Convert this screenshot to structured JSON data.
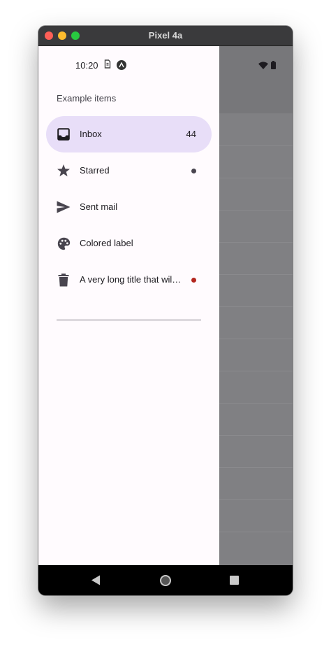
{
  "window": {
    "title": "Pixel 4a"
  },
  "status_bar": {
    "time": "10:20",
    "icons": [
      "sim-icon",
      "app-notification-icon",
      "wifi-icon",
      "battery-icon"
    ]
  },
  "drawer": {
    "headline": "Example items",
    "items": [
      {
        "label": "Inbox",
        "icon": "inbox-icon",
        "badge": "44",
        "selected": true
      },
      {
        "label": "Starred",
        "icon": "star-icon",
        "dot_color": "#49454f"
      },
      {
        "label": "Sent mail",
        "icon": "send-icon"
      },
      {
        "label": "Colored label",
        "icon": "palette-icon"
      },
      {
        "label": "A very long title that will be truncated",
        "icon": "trash-icon",
        "dot_color": "#b3261e"
      }
    ]
  },
  "nav_bar": {
    "buttons": [
      "back-button",
      "home-button",
      "recents-button"
    ]
  },
  "colors": {
    "selected_indicator": "#e8def8",
    "drawer_surface": "#fffbfe",
    "scrim": "#808083"
  }
}
